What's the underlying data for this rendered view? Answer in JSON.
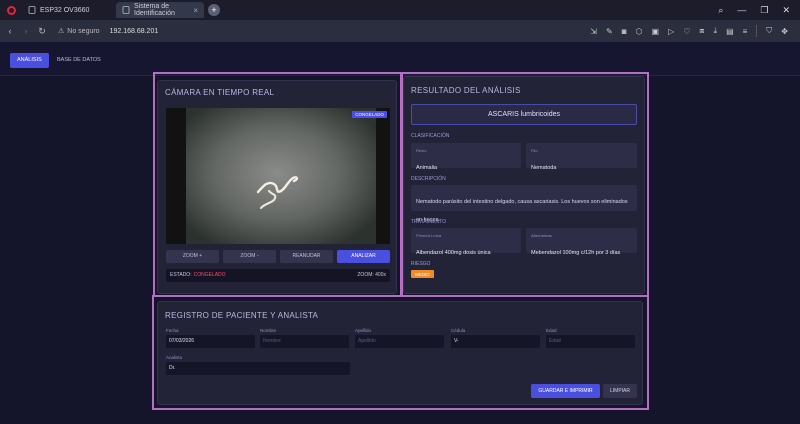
{
  "browser": {
    "tabs": [
      {
        "label": "ESP32 OV3660"
      },
      {
        "label": "Sistema de Identificación"
      }
    ],
    "new_tab": "+",
    "not_secure": "No seguro",
    "url": "192.168.68.201"
  },
  "nav": {
    "analysis": "ANÁLISIS",
    "database": "BASE DE DATOS"
  },
  "camera": {
    "title": "CÁMARA EN TIEMPO REAL",
    "frozen_badge": "CONGELADO",
    "buttons": [
      "ZOOM +",
      "ZOOM -",
      "REANUDAR",
      "ANALIZAR"
    ],
    "status_label": "ESTADO:",
    "status_value": "CONGELADO",
    "zoom_label": "ZOOM: 400x"
  },
  "result": {
    "title": "RESULTADO DEL ANÁLISIS",
    "species": "ASCARIS lumbricoides",
    "classification_label": "CLASIFICACIÓN",
    "kingdom_key": "Reino",
    "kingdom_value": "Animalia",
    "phylum_key": "Filo",
    "phylum_value": "Nematoda",
    "description_label": "DESCRIPCIÓN",
    "description": "Nematodo parásito del intestino delgado, causa ascariasis. Los huevos son eliminados en heces.",
    "treatment_label": "TRATAMIENTO",
    "primary_key": "Primera Línea",
    "primary_value": "Albendazol 400mg dosis única",
    "alt_key": "Alternativas",
    "alt_value": "Mebendazol 100mg c/12h por 3 días",
    "risk_label": "RIESGO",
    "risk_value": "MEDIO"
  },
  "registro": {
    "title": "REGISTRO DE PACIENTE Y ANALISTA",
    "fecha_label": "Fecha",
    "fecha_value": "07/03/2026",
    "nombre_label": "Nombre",
    "nombre_placeholder": "Nombre",
    "apellido_label": "Apellido",
    "apellido_placeholder": "Apellido",
    "cedula_label": "Cédula",
    "cedula_value": "V-",
    "edad_label": "Edad",
    "edad_placeholder": "Edad",
    "analista_label": "Analista",
    "analista_value": "Dr.",
    "save": "GUARDAR E IMPRIMIR",
    "clear": "LIMPIAR"
  },
  "colors": {
    "accent": "#4b4fe0",
    "highlight": "#b56ec2",
    "risk": "#f08a2a",
    "frozen_status": "#ef4f6a"
  }
}
